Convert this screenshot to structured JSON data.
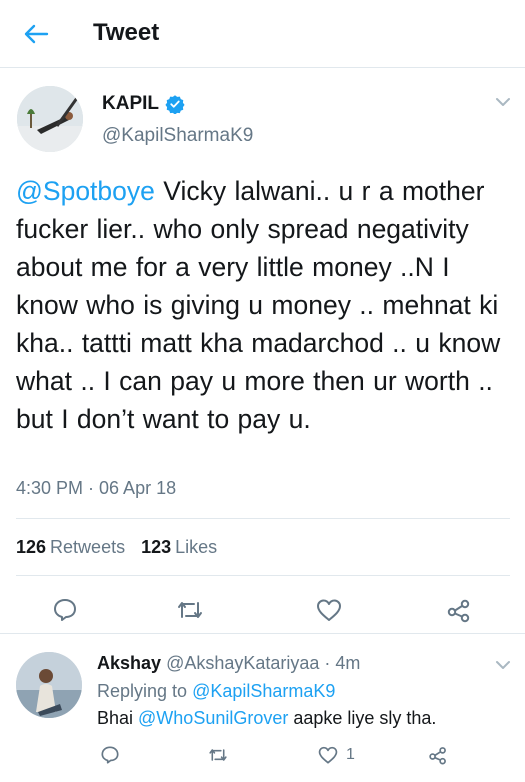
{
  "header": {
    "title": "Tweet",
    "back_icon": "arrow-left-icon"
  },
  "tweet": {
    "author_name": "KAPIL",
    "author_handle": "@KapilSharmaK9",
    "mention": "@Spotboye",
    "text": " Vicky lalwani.. u r a mother fucker lier.. who only spread negativity about me for a very little money ..N I know who is giving u money .. mehnat ki kha.. tattti matt kha madarchod .. u know what .. I can pay u more then ur worth .. but I don’t want to pay u.",
    "timestamp": "4:30 PM · 06 Apr 18",
    "retweets_count": "126",
    "retweets_label": "Retweets",
    "likes_count": "123",
    "likes_label": "Likes"
  },
  "reply": {
    "name": "Akshay",
    "handle_time": "@AkshayKatariyaa · 4m",
    "replying_prefix": "Replying to ",
    "replying_to": "@KapilSharmaK9",
    "text_prefix": "Bhai ",
    "mention": "@WhoSunilGrover",
    "text_suffix": " aapke liye sly tha.",
    "likes_count": "1"
  },
  "colors": {
    "accent": "#1da1f2",
    "secondary_text": "#657786",
    "border": "#e1e8ed",
    "verified": "#1da1f2"
  }
}
